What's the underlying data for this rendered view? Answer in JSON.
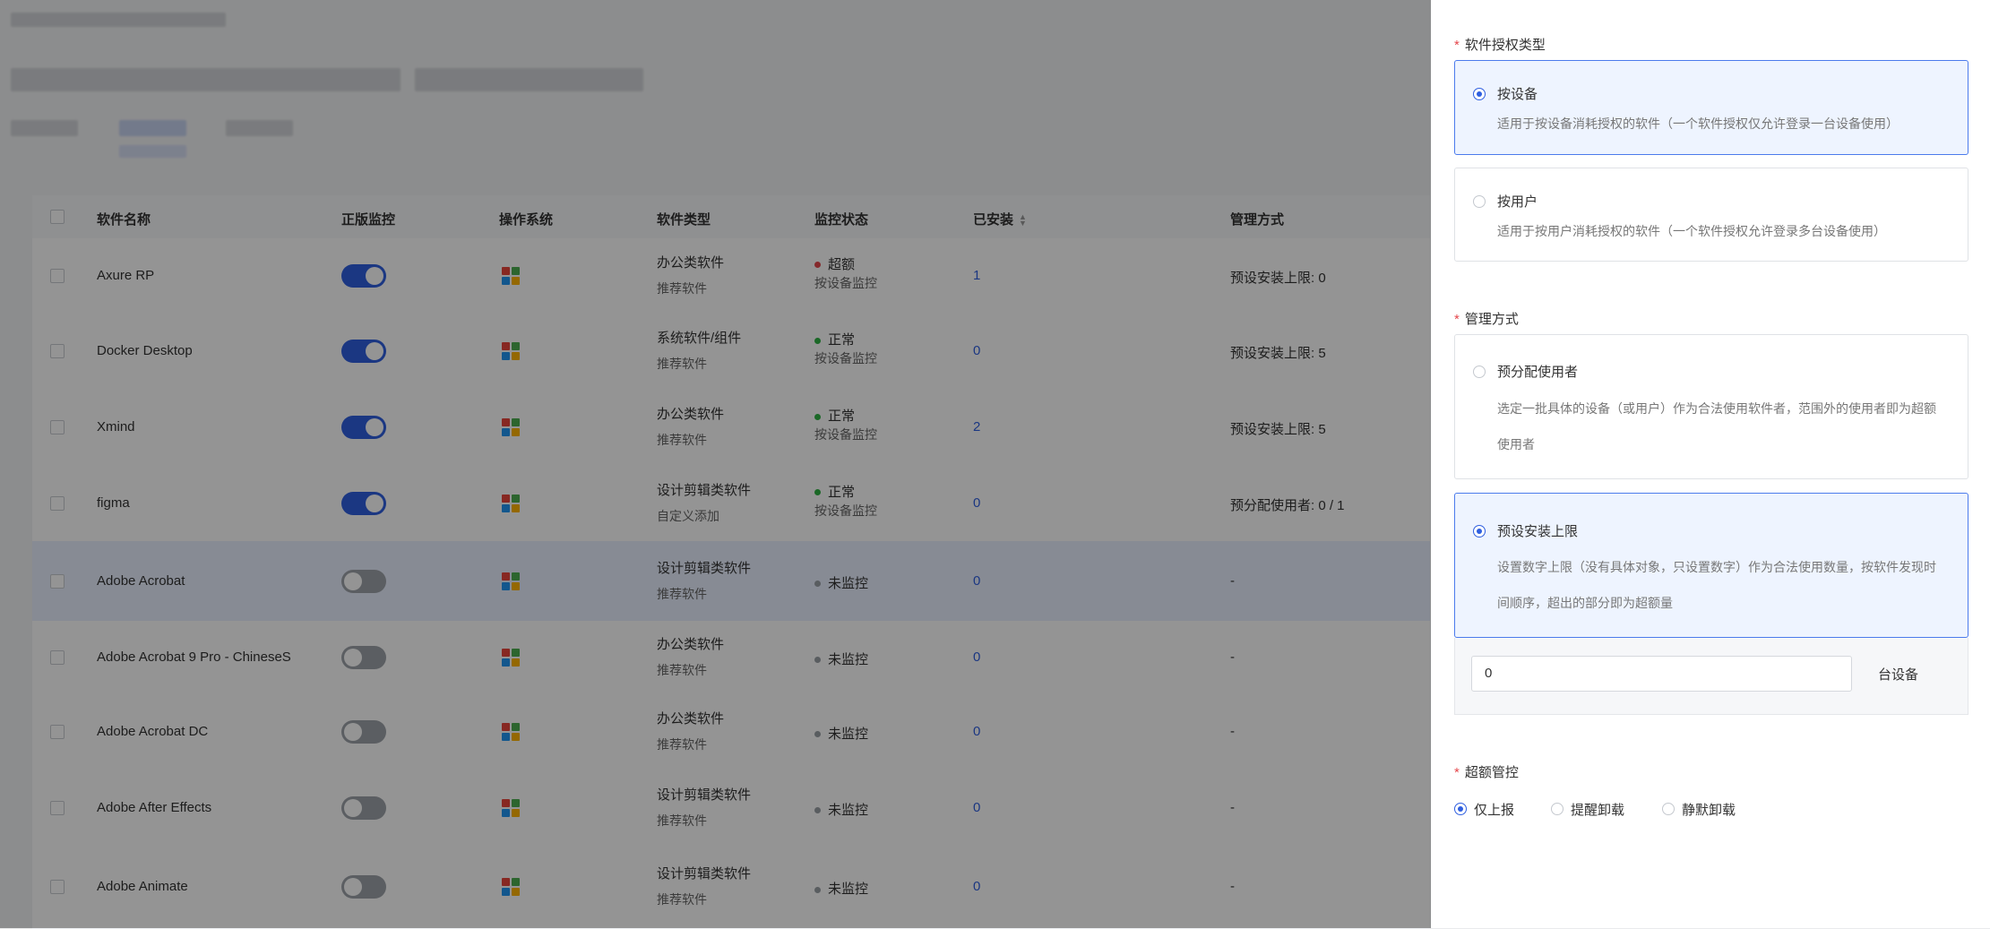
{
  "table": {
    "headers": {
      "name": "软件名称",
      "genuine": "正版监控",
      "os": "操作系统",
      "type": "软件类型",
      "status": "监控状态",
      "installed": "已安装",
      "mgmt": "管理方式"
    },
    "rows": [
      {
        "name": "Axure RP",
        "monitor_on": true,
        "type": "办公类软件",
        "source": "推荐软件",
        "status": "超额",
        "status_color": "#e5484d",
        "status_sub": "按设备监控",
        "installed": "1",
        "mgmt": "预设安装上限:  0"
      },
      {
        "name": "Docker Desktop",
        "monitor_on": true,
        "type": "系统软件/组件",
        "source": "推荐软件",
        "status": "正常",
        "status_color": "#2fb344",
        "status_sub": "按设备监控",
        "installed": "0",
        "mgmt": "预设安装上限:  5"
      },
      {
        "name": "Xmind",
        "monitor_on": true,
        "type": "办公类软件",
        "source": "推荐软件",
        "status": "正常",
        "status_color": "#2fb344",
        "status_sub": "按设备监控",
        "installed": "2",
        "mgmt": "预设安装上限:  5"
      },
      {
        "name": "figma",
        "monitor_on": true,
        "type": "设计剪辑类软件",
        "source": "自定义添加",
        "status": "正常",
        "status_color": "#2fb344",
        "status_sub": "按设备监控",
        "installed": "0",
        "mgmt": "预分配使用者:  0 / 1"
      },
      {
        "name": "Adobe Acrobat",
        "monitor_on": false,
        "type": "设计剪辑类软件",
        "source": "推荐软件",
        "status": "未监控",
        "status_color": "#9aa0a6",
        "status_sub": "",
        "installed": "0",
        "mgmt": "-"
      },
      {
        "name": "Adobe Acrobat 9 Pro - ChineseS",
        "monitor_on": false,
        "type": "办公类软件",
        "source": "推荐软件",
        "status": "未监控",
        "status_color": "#9aa0a6",
        "status_sub": "",
        "installed": "0",
        "mgmt": "-"
      },
      {
        "name": "Adobe Acrobat DC",
        "monitor_on": false,
        "type": "办公类软件",
        "source": "推荐软件",
        "status": "未监控",
        "status_color": "#9aa0a6",
        "status_sub": "",
        "installed": "0",
        "mgmt": "-"
      },
      {
        "name": "Adobe After Effects",
        "monitor_on": false,
        "type": "设计剪辑类软件",
        "source": "推荐软件",
        "status": "未监控",
        "status_color": "#9aa0a6",
        "status_sub": "",
        "installed": "0",
        "mgmt": "-"
      },
      {
        "name": "Adobe Animate",
        "monitor_on": false,
        "type": "设计剪辑类软件",
        "source": "推荐软件",
        "status": "未监控",
        "status_color": "#9aa0a6",
        "status_sub": "",
        "installed": "0",
        "mgmt": "-"
      }
    ]
  },
  "drawer": {
    "license_type": {
      "title": "软件授权类型",
      "options": [
        {
          "label": "按设备",
          "desc": "适用于按设备消耗授权的软件（一个软件授权仅允许登录一台设备使用）",
          "checked": true
        },
        {
          "label": "按用户",
          "desc": "适用于按用户消耗授权的软件（一个软件授权允许登录多台设备使用）",
          "checked": false
        }
      ]
    },
    "management": {
      "title": "管理方式",
      "options": [
        {
          "label": "预分配使用者",
          "desc": "选定一批具体的设备（或用户）作为合法使用软件者，范围外的使用者即为超额使用者",
          "checked": false
        },
        {
          "label": "预设安装上限",
          "desc": "设置数字上限（没有具体对象，只设置数字）作为合法使用数量，按软件发现时间顺序，超出的部分即为超额量",
          "checked": true
        }
      ],
      "limit_value": "0",
      "limit_unit": "台设备"
    },
    "overage": {
      "title": "超额管控",
      "options": [
        {
          "label": "仅上报",
          "checked": true
        },
        {
          "label": "提醒卸载",
          "checked": false
        },
        {
          "label": "静默卸载",
          "checked": false
        }
      ]
    }
  },
  "colors": {
    "accent": "#2f5fe0",
    "windows_logo": [
      "#e8453c",
      "#4caf50",
      "#2196f3",
      "#ffb300"
    ]
  }
}
